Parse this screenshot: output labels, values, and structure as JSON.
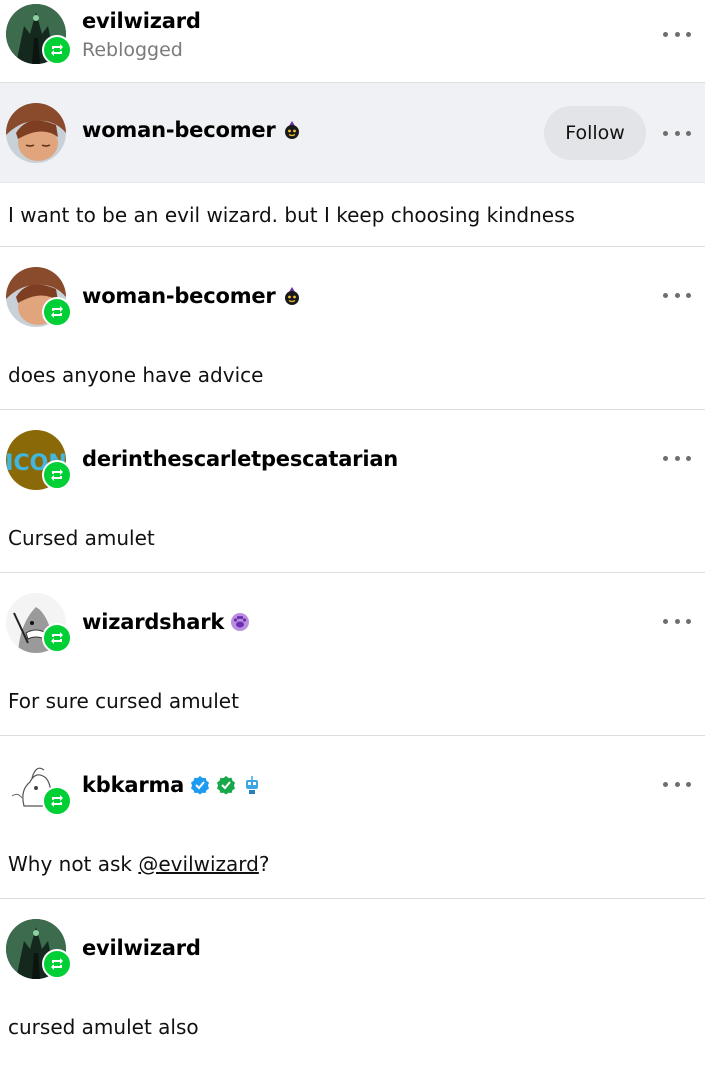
{
  "header": {
    "username": "evilwizard",
    "status": "Reblogged"
  },
  "original_post": {
    "username": "woman-becomer",
    "follow_label": "Follow",
    "text": "I want to be an evil wizard. but I keep choosing kindness"
  },
  "reblogs": [
    {
      "username": "woman-becomer",
      "text": "does anyone have advice"
    },
    {
      "username": "derinthescarletpescatarian",
      "avatar_text": "ICON",
      "text": "Cursed amulet"
    },
    {
      "username": "wizardshark",
      "text": "For sure cursed amulet"
    },
    {
      "username": "kbkarma",
      "text_before": "Why not ask ",
      "mention": "@evilwizard",
      "text_after": "?"
    },
    {
      "username": "evilwizard",
      "text": "cursed amulet also"
    }
  ],
  "colors": {
    "reblog_green": "#00cf35",
    "highlight_bg": "#f0f1f4",
    "follow_bg": "#e3e4e7",
    "verified_blue": "#1d9bf0",
    "verified_green": "#18a84a"
  },
  "icons": [
    "reblog-icon",
    "more-options-icon",
    "halloween-badge-icon",
    "paw-badge-icon",
    "verified-badge-icon",
    "robot-badge-icon"
  ]
}
